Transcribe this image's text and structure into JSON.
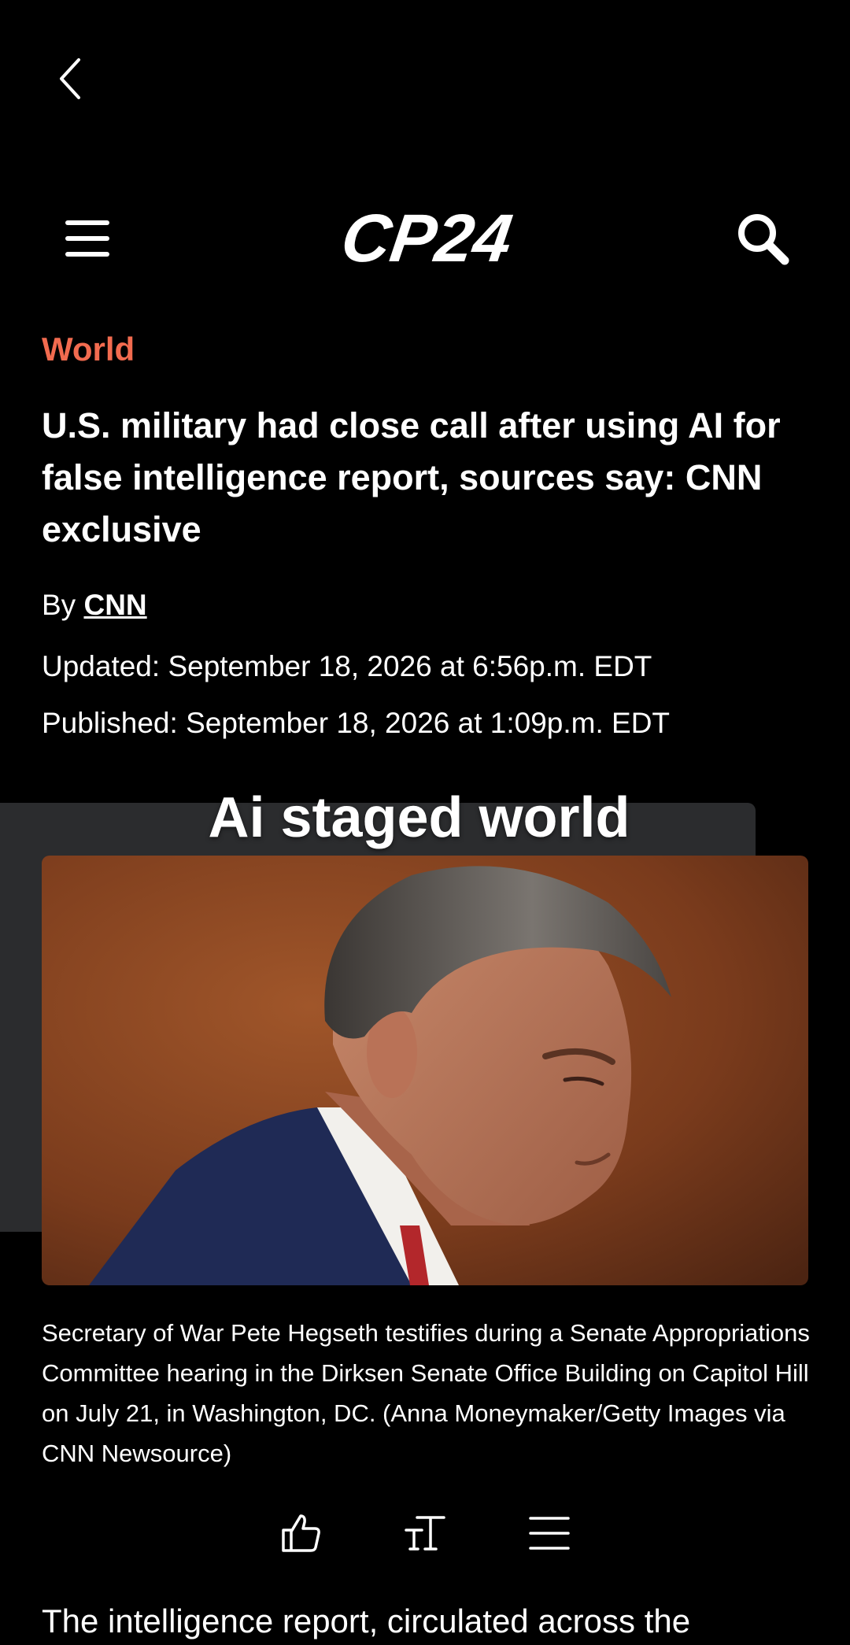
{
  "header": {
    "back_icon": "chevron-left-icon",
    "menu_icon": "hamburger-menu-icon",
    "logo_text": "CP24",
    "search_icon": "search-icon"
  },
  "article": {
    "category": "World",
    "headline": "U.S. military had close call after using AI for false intelligence report, sources say: CNN exclusive",
    "byline_prefix": "By",
    "byline_author": "CNN",
    "updated": "Updated: September 18, 2026 at 6:56p.m. EDT",
    "published": "Published: September 18, 2026 at 1:09p.m. EDT",
    "image_overlay_text": "Ai staged world",
    "caption": "Secretary of War Pete Hegseth testifies during a Senate Appropriations Committee hearing in the Dirksen Senate Office Building on Capitol Hill on July 21, in Washington, DC. (Anna Moneymaker/Getty Images via CNN Newsource)",
    "body_first_line": "The intelligence report, circulated across the"
  },
  "actions": {
    "like_icon": "thumbs-up-icon",
    "text_size_icon": "text-size-icon",
    "toc_icon": "list-icon"
  },
  "colors": {
    "background": "#000000",
    "category": "#f26b4f",
    "panel": "#2b2c2e",
    "text": "#ffffff"
  }
}
